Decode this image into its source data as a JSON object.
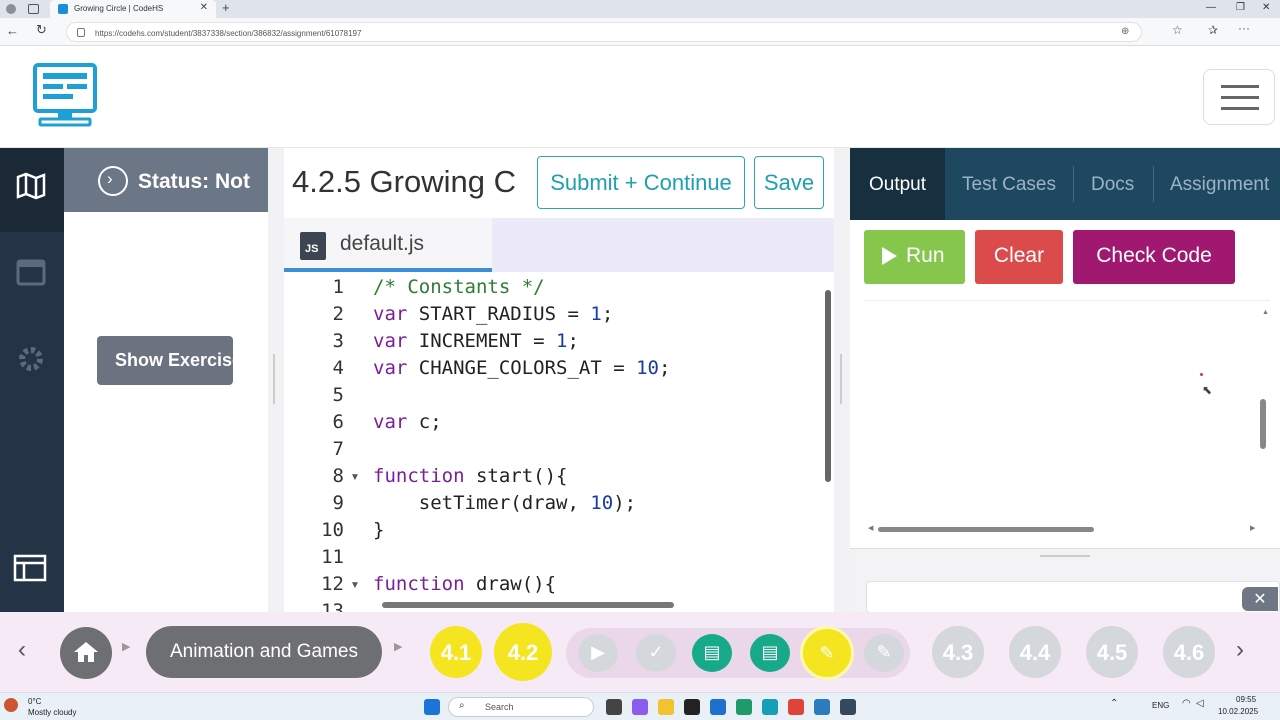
{
  "browser": {
    "tab_title": "Growing Circle | CodeHS",
    "url": "https://codehs.com/student/3837338/section/386832/assignment/61078197"
  },
  "left_rail": {
    "items": [
      "map-icon",
      "calendar-icon",
      "gear-icon",
      "layout-icon"
    ]
  },
  "status_panel": {
    "status_label": "Status: Not",
    "show_button": "Show Exercise"
  },
  "editor": {
    "title": "4.2.5 Growing C",
    "submit_label": "Submit + Continue",
    "save_label": "Save",
    "file_icon": "JS",
    "file_name": "default.js",
    "lines": [
      {
        "n": "1",
        "text": "/* Constants */"
      },
      {
        "n": "2",
        "text": "var START_RADIUS = 1;"
      },
      {
        "n": "3",
        "text": "var INCREMENT = 1;"
      },
      {
        "n": "4",
        "text": "var CHANGE_COLORS_AT = 10;"
      },
      {
        "n": "5",
        "text": ""
      },
      {
        "n": "6",
        "text": "var c;"
      },
      {
        "n": "7",
        "text": ""
      },
      {
        "n": "8",
        "text": "function start(){"
      },
      {
        "n": "9",
        "text": "    setTimer(draw, 10);"
      },
      {
        "n": "10",
        "text": "}"
      },
      {
        "n": "11",
        "text": ""
      },
      {
        "n": "12",
        "text": "function draw(){"
      },
      {
        "n": "13",
        "text": ""
      }
    ]
  },
  "right_panel": {
    "tabs": [
      "Output",
      "Test Cases",
      "Docs",
      "Assignment"
    ],
    "active_tab": "Output",
    "run_label": "Run",
    "clear_label": "Clear",
    "check_label": "Check Code"
  },
  "lesson_bar": {
    "topic": "Animation and Games",
    "lessons": [
      "4.1",
      "4.2",
      "4.3",
      "4.4",
      "4.5",
      "4.6"
    ],
    "activity_icons": [
      "video-icon",
      "check-icon",
      "doc-icon",
      "doc-icon",
      "pencil-icon",
      "pencil-icon"
    ]
  },
  "taskbar": {
    "weather_temp": "0°C",
    "weather_desc": "Mostly cloudy",
    "search_placeholder": "Search",
    "lang": "ENG",
    "time": "09:55",
    "date": "10.02.2025"
  },
  "colors": {
    "rail": "#243446",
    "accent_teal": "#2aa6b4",
    "run_green": "#86c64d",
    "clear_red": "#dc4b4b",
    "check_purple": "#a0186f",
    "lesson_yellow": "#f4e520"
  }
}
